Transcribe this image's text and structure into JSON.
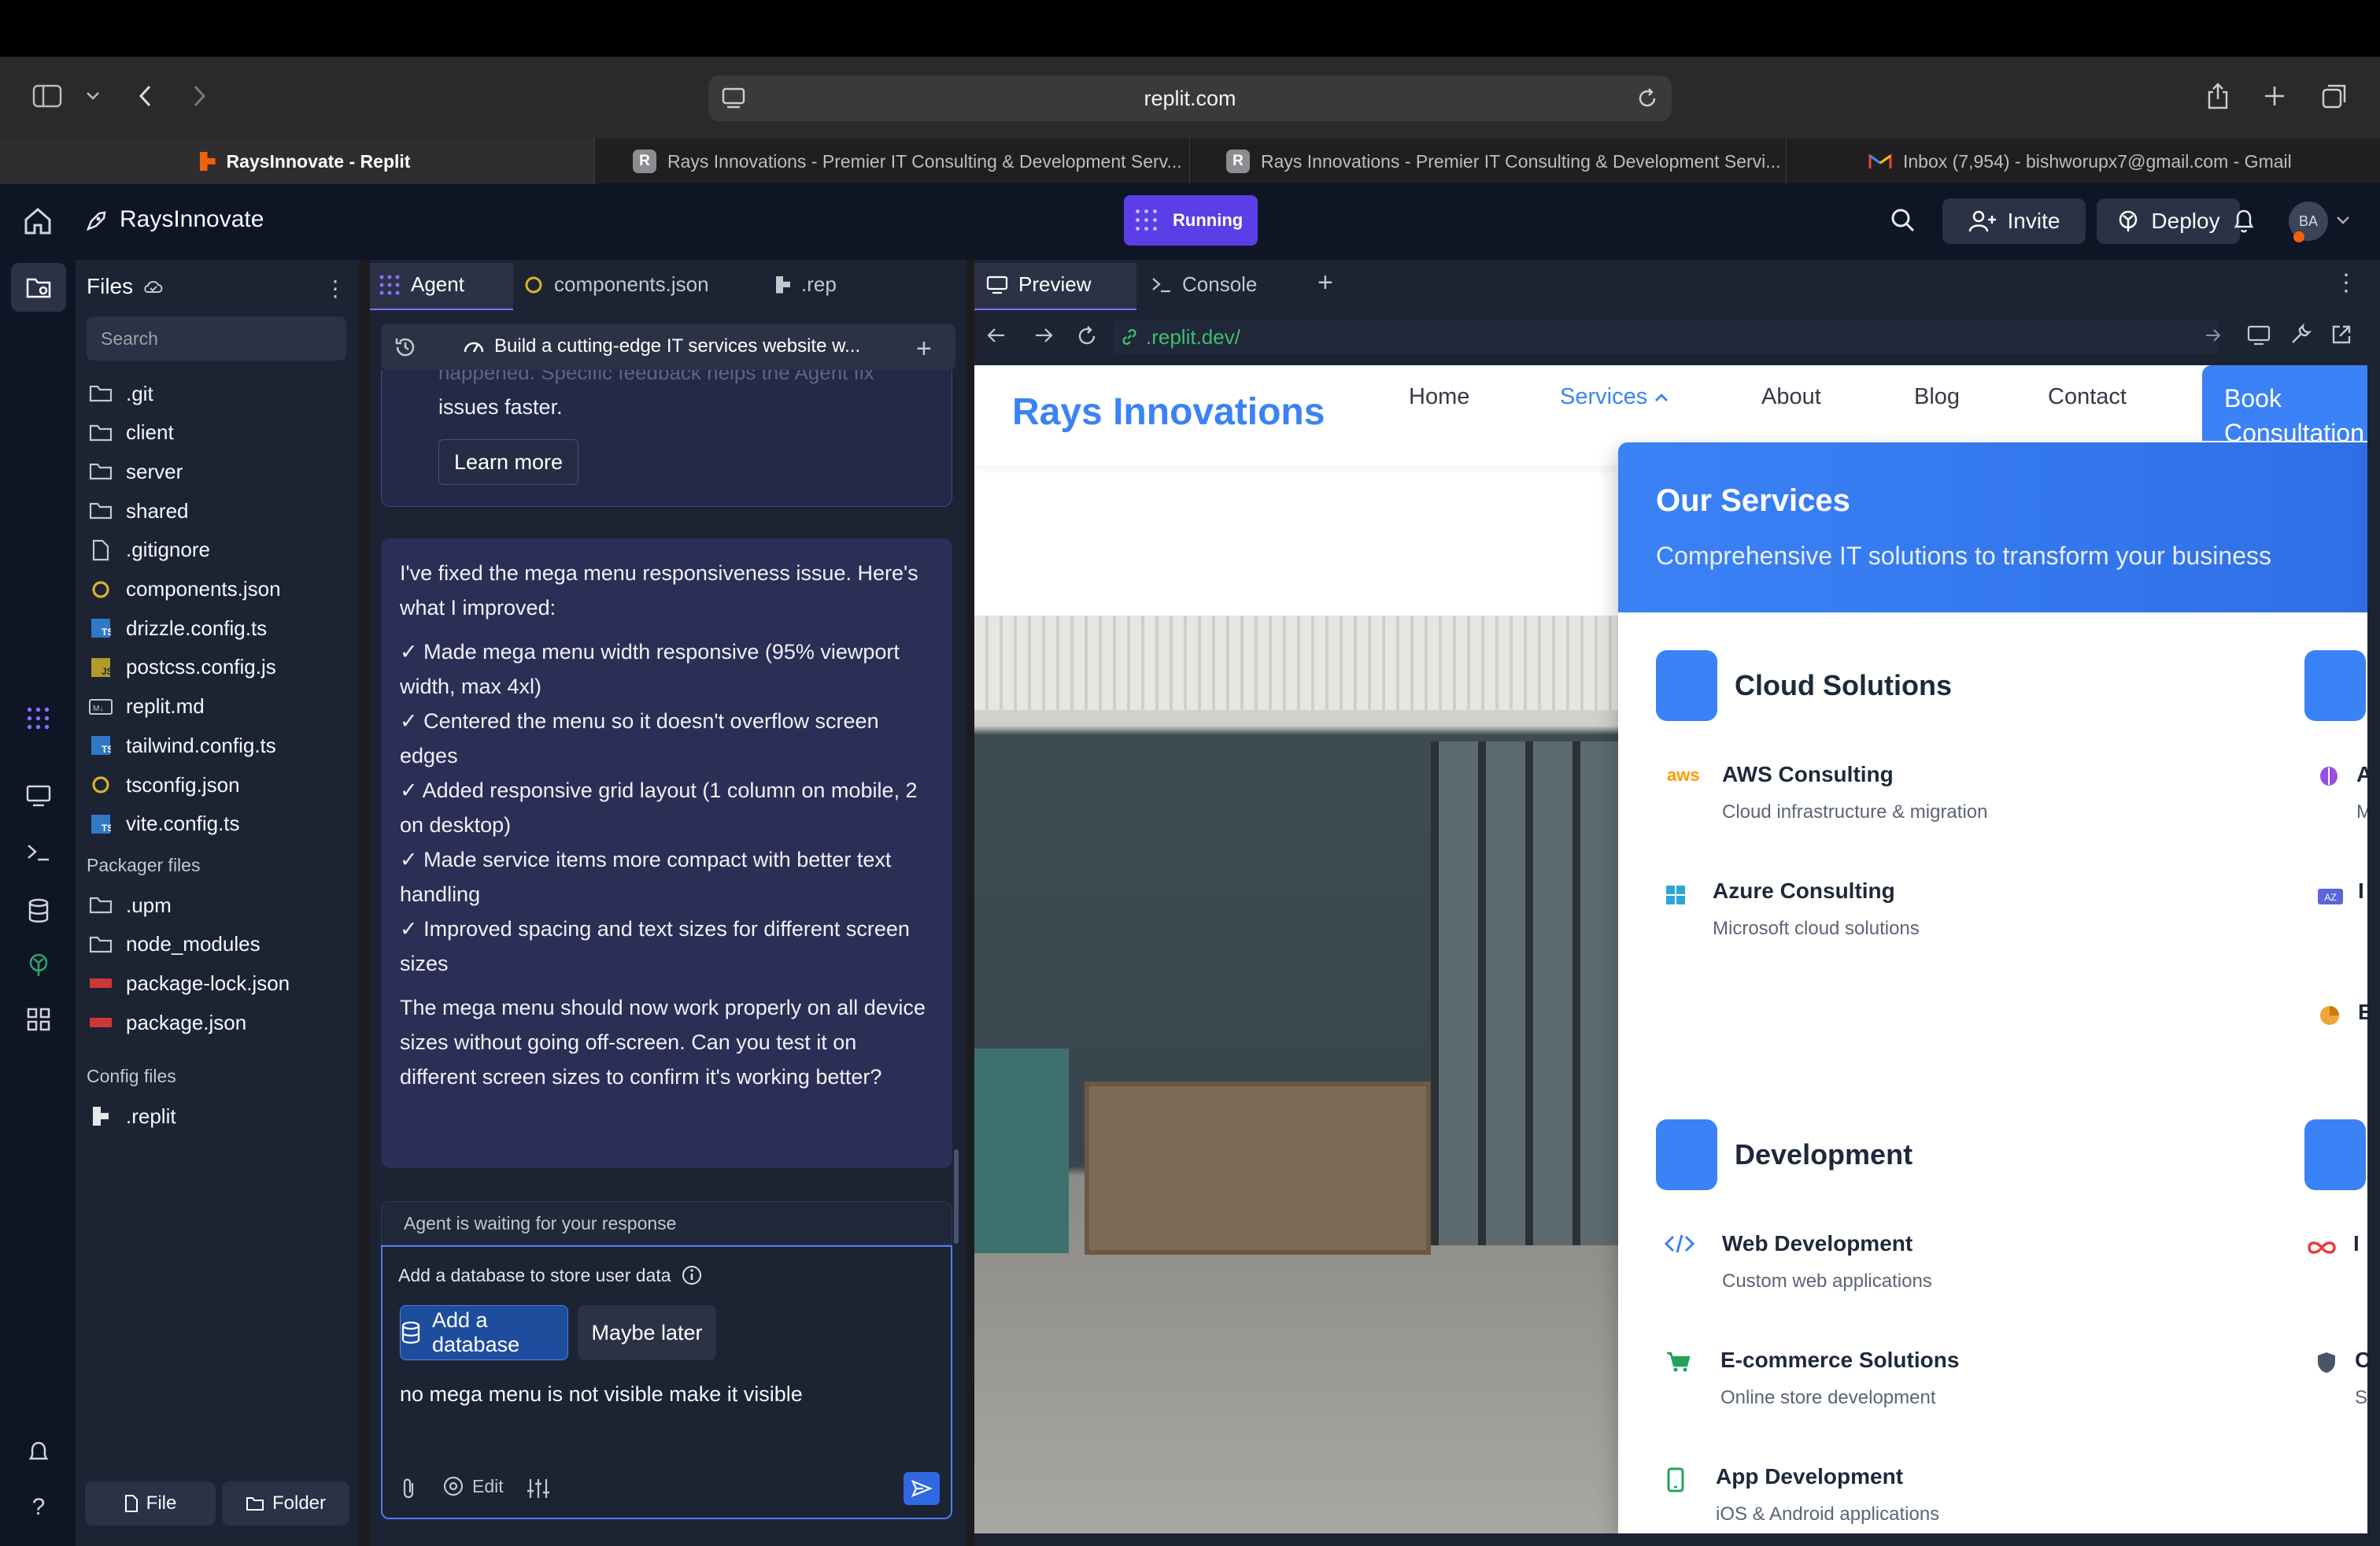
{
  "browser": {
    "url": "replit.com",
    "tabs": [
      {
        "title": "RaysInnovate - Replit",
        "active": true
      },
      {
        "title": "Rays Innovations - Premier IT Consulting & Development Serv...",
        "active": false
      },
      {
        "title": "Rays Innovations - Premier IT Consulting & Development Servi...",
        "active": false
      },
      {
        "title": "Inbox (7,954) - bishworupx7@gmail.com - Gmail",
        "active": false
      }
    ]
  },
  "app": {
    "project_name": "RaysInnovate",
    "status": "Running",
    "invite_label": "Invite",
    "deploy_label": "Deploy",
    "avatar_initials": "BA"
  },
  "files": {
    "title": "Files",
    "search_placeholder": "Search",
    "items": [
      ".git",
      "client",
      "server",
      "shared",
      ".gitignore",
      "components.json",
      "drizzle.config.ts",
      "postcss.config.js",
      "replit.md",
      "tailwind.config.ts",
      "tsconfig.json",
      "vite.config.ts"
    ],
    "packager_title": "Packager files",
    "packager_items": [
      ".upm",
      "node_modules",
      "package-lock.json",
      "package.json"
    ],
    "config_title": "Config files",
    "config_items": [
      ".replit"
    ],
    "new_file_label": "File",
    "new_folder_label": "Folder"
  },
  "agent": {
    "tabs": [
      "Agent",
      "components.json",
      ".rep"
    ],
    "thread_title": "Build a cutting-edge IT services website w...",
    "prev_fragment": "happened. Specific feedback helps the Agent fix",
    "prev_fragment2": "issues faster.",
    "learn_more": "Learn more",
    "message_intro": "I've fixed the mega menu responsiveness issue. Here's what I improved:",
    "checklist": [
      "✓ Made mega menu width responsive (95% viewport width, max 4xl)",
      "✓ Centered the menu so it doesn't overflow screen edges",
      "✓ Added responsive grid layout (1 column on mobile, 2 on desktop)",
      "✓ Made service items more compact with better text handling",
      "✓ Improved spacing and text sizes for different screen sizes"
    ],
    "message_outro": "The mega menu should now work properly on all device sizes without going off-screen. Can you test it on different screen sizes to confirm it's working better?",
    "waiting_text": "Agent is waiting for your response",
    "db_prompt": "Add a database to store user data",
    "add_db_label": "Add a database",
    "maybe_later_label": "Maybe later",
    "input_value": "no mega menu is not visible make it visible",
    "edit_label": "Edit"
  },
  "preview": {
    "tabs": [
      "Preview",
      "Console"
    ],
    "url": ".replit.dev/",
    "site": {
      "logo": "Rays Innovations",
      "nav": [
        "Home",
        "Services",
        "About",
        "Blog",
        "Contact"
      ],
      "cta": "Book Consultation",
      "mega_title": "Our Services",
      "mega_subtitle": "Comprehensive IT solutions to transform your business",
      "categories": [
        {
          "title": "Cloud Solutions",
          "items": [
            {
              "name": "AWS Consulting",
              "desc": "Cloud infrastructure & migration",
              "icon": "aws-icon"
            },
            {
              "name": "Azure Consulting",
              "desc": "Microsoft cloud solutions",
              "icon": "windows-icon"
            }
          ]
        },
        {
          "title": "Development",
          "items": [
            {
              "name": "Web Development",
              "desc": "Custom web applications",
              "icon": "code-icon"
            },
            {
              "name": "E-commerce Solutions",
              "desc": "Online store development",
              "icon": "cart-icon"
            },
            {
              "name": "App Development",
              "desc": "iOS & Android applications",
              "icon": "phone-icon"
            }
          ]
        }
      ],
      "right_col_fragments": [
        "A",
        "M",
        "I",
        "E",
        "C",
        "S"
      ]
    }
  },
  "colors": {
    "accent_blue": "#3b82f6",
    "logo_blue": "#3b82f6",
    "running_purple": "#5b3ee6",
    "agent_card": "#2b2f55"
  }
}
